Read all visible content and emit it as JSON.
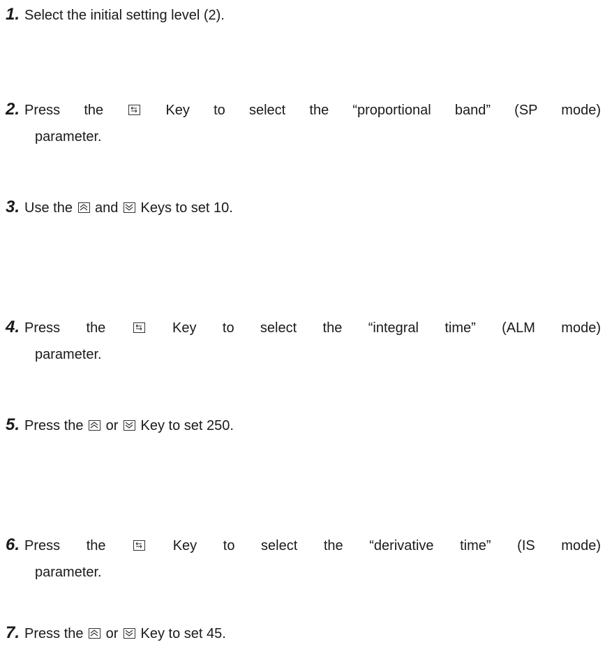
{
  "steps": [
    {
      "number": "1.",
      "parts": [
        "Select the initial setting level (2)."
      ],
      "cont": ""
    },
    {
      "number": "2.",
      "parts": [
        "Press the ",
        " Key to select the “proportional band” (SP mode)"
      ],
      "keys": [
        "mode-key"
      ],
      "cont": "parameter."
    },
    {
      "number": "3.",
      "parts": [
        "Use the ",
        " and ",
        " Keys to set 10."
      ],
      "keys": [
        "up-key",
        "down-key"
      ],
      "cont": ""
    },
    {
      "number": "4.",
      "parts": [
        "Press the ",
        " Key to select the “integral time” (ALM mode)"
      ],
      "keys": [
        "mode-key"
      ],
      "cont": "parameter."
    },
    {
      "number": "5.",
      "parts": [
        "Press the ",
        " or ",
        " Key to set 250."
      ],
      "keys": [
        "up-key",
        "down-key"
      ],
      "cont": ""
    },
    {
      "number": "6.",
      "parts": [
        "Press the ",
        " Key to select the “derivative time” (IS mode)"
      ],
      "keys": [
        "mode-key"
      ],
      "cont": "parameter."
    },
    {
      "number": "7.",
      "parts": [
        "Press the ",
        " or ",
        " Key to set 45."
      ],
      "keys": [
        "up-key",
        "down-key"
      ],
      "cont": ""
    }
  ]
}
